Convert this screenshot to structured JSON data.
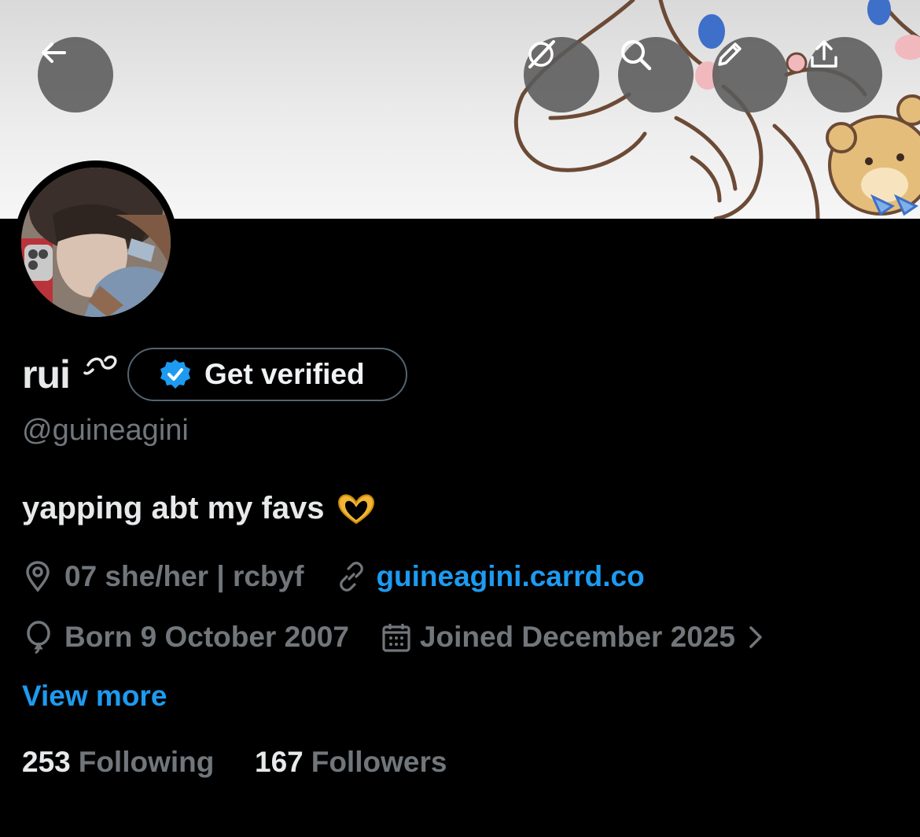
{
  "profile": {
    "display_name": "rui",
    "verify_label": "Get verified",
    "handle": "@guineagini",
    "bio": "yapping abt my favs",
    "location": "07 she/her | rcbyf",
    "website": "guineagini.carrd.co",
    "born": "Born 9 October 2007",
    "joined": "Joined December 2025",
    "view_more": "View more",
    "following_count": "253",
    "following_label": "Following",
    "followers_count": "167",
    "followers_label": "Followers"
  },
  "colors": {
    "accent": "#1d9bf0",
    "muted_text": "#71767b",
    "primary_text": "#e7e9ea",
    "background": "#000000"
  },
  "icons": [
    "back-arrow-icon",
    "grok-icon",
    "search-icon",
    "edit-pencil-icon",
    "share-icon",
    "verified-badge-icon",
    "location-pin-icon",
    "link-icon",
    "balloon-icon",
    "calendar-icon",
    "chevron-right-icon",
    "heart-hands-emoji"
  ]
}
